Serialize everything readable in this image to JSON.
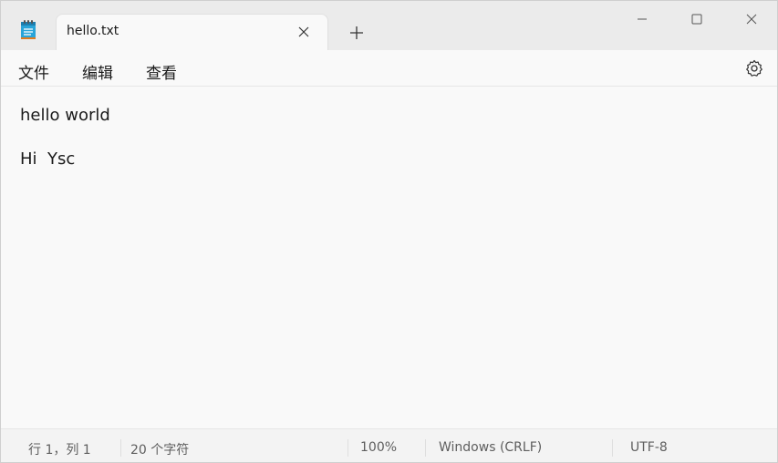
{
  "tab": {
    "title": "hello.txt"
  },
  "menu": {
    "file": "文件",
    "edit": "编辑",
    "view": "查看"
  },
  "editor": {
    "lines": [
      "hello world",
      "",
      "Hi  Ysc"
    ]
  },
  "status": {
    "position": "行 1，列 1",
    "chars": "20 个字符",
    "zoom": "100%",
    "line_ending": "Windows (CRLF)",
    "encoding": "UTF-8"
  },
  "colors": {
    "accent": "#0f6cbd",
    "text": "#1a1a1a",
    "status_text": "#5e5e5e"
  },
  "icons": {
    "app": "notepad-icon",
    "close_tab": "close-icon",
    "new_tab": "plus-icon",
    "minimize": "minimize-icon",
    "maximize": "maximize-icon",
    "close": "close-icon",
    "settings": "gear-icon"
  }
}
